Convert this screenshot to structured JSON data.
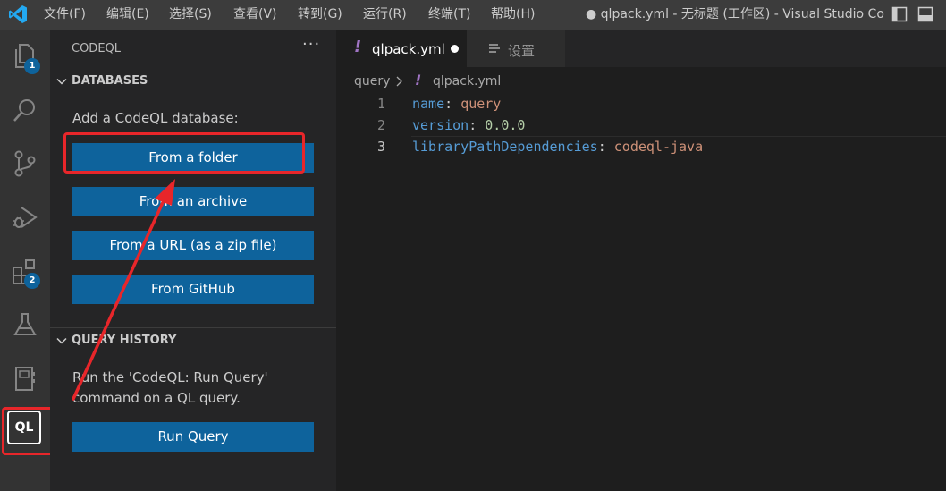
{
  "titlebar": {
    "menus": [
      "文件(F)",
      "编辑(E)",
      "选择(S)",
      "查看(V)",
      "转到(G)",
      "运行(R)",
      "终端(T)",
      "帮助(H)"
    ],
    "window_title": "● qlpack.yml - 无标题 (工作区) - Visual Studio Co..."
  },
  "activity_bar": {
    "items": [
      {
        "icon": "explorer-icon",
        "badge": "1"
      },
      {
        "icon": "search-icon"
      },
      {
        "icon": "source-control-icon"
      },
      {
        "icon": "run-debug-icon"
      },
      {
        "icon": "extensions-icon",
        "badge": "2"
      },
      {
        "icon": "testing-icon"
      },
      {
        "icon": "notebook-icon"
      },
      {
        "icon": "codeql-icon",
        "label": "QL"
      }
    ]
  },
  "sidebar": {
    "title": "CODEQL",
    "more": "···",
    "databases": {
      "title": "DATABASES",
      "prompt": "Add a CodeQL database:",
      "buttons": [
        "From a folder",
        "From an archive",
        "From a URL (as a zip file)",
        "From GitHub"
      ]
    },
    "query_history": {
      "title": "QUERY HISTORY",
      "text_line1": "Run the 'CodeQL: Run Query'",
      "text_line2": "command on a QL query.",
      "button": "Run Query"
    }
  },
  "tabs": [
    {
      "label": "qlpack.yml",
      "icon": "!",
      "dirty": true,
      "active": true
    },
    {
      "label": "设置",
      "icon": "settings-icon",
      "active": false
    }
  ],
  "breadcrumb": {
    "folder": "query",
    "icon": "!",
    "file": "qlpack.yml"
  },
  "editor": {
    "lines": [
      {
        "num": "1",
        "key": "name",
        "sep": ": ",
        "value": "query",
        "value_type": "string"
      },
      {
        "num": "2",
        "key": "version",
        "sep": ": ",
        "value": "0.0.0",
        "value_type": "number"
      },
      {
        "num": "3",
        "key": "libraryPathDependencies",
        "sep": ": ",
        "value": "codeql-java",
        "value_type": "string"
      }
    ],
    "current_line": "3"
  },
  "colors": {
    "accent_button": "#0e639c",
    "annotation_red": "#e8262a",
    "yaml_key": "#569cd6",
    "yaml_string": "#ce9178",
    "yaml_number": "#b5cea8"
  }
}
